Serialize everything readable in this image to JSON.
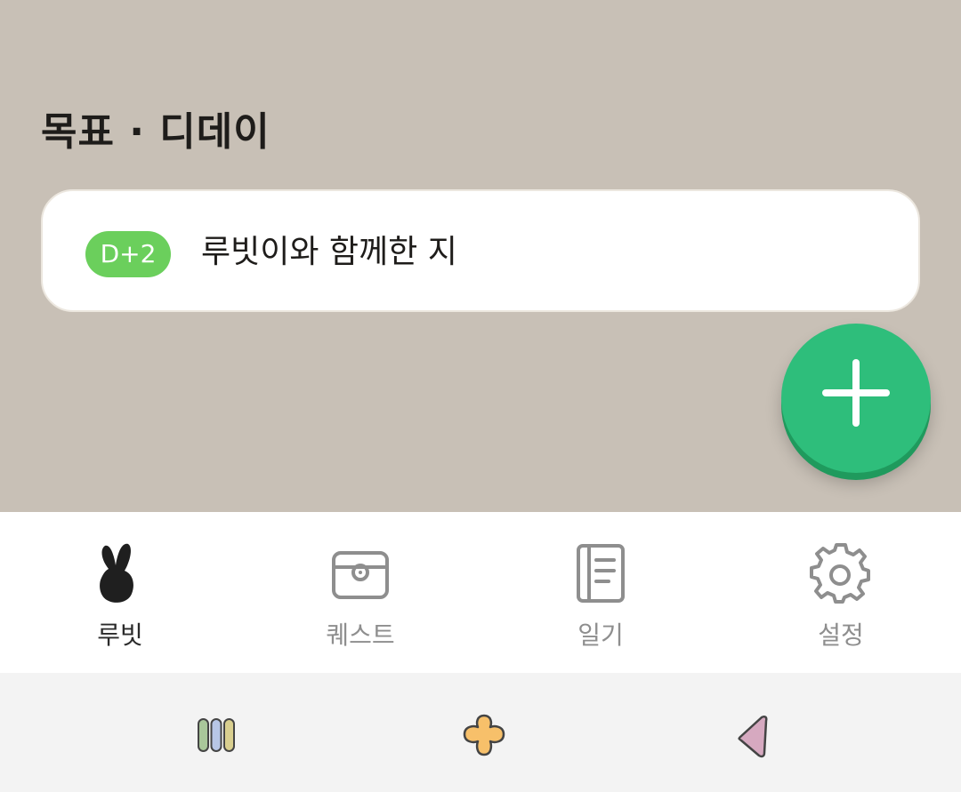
{
  "section": {
    "title": "목표 · 디데이"
  },
  "dday_items": [
    {
      "badge": "D+2",
      "label": "루빗이와 함께한 지",
      "badge_color": "#6bcf5c"
    }
  ],
  "fab": {
    "icon": "plus-icon",
    "color": "#2ebe7b"
  },
  "tabs": [
    {
      "label": "루빗",
      "icon": "rabbit-icon",
      "active": true
    },
    {
      "label": "퀘스트",
      "icon": "chest-icon",
      "active": false
    },
    {
      "label": "일기",
      "icon": "notebook-icon",
      "active": false
    },
    {
      "label": "설정",
      "icon": "gear-icon",
      "active": false
    }
  ],
  "system_nav": [
    {
      "icon": "recent-apps-icon"
    },
    {
      "icon": "home-icon"
    },
    {
      "icon": "back-icon"
    }
  ],
  "colors": {
    "background": "#c8c0b6",
    "accent": "#2ebe7b",
    "badge": "#6bcf5c"
  }
}
